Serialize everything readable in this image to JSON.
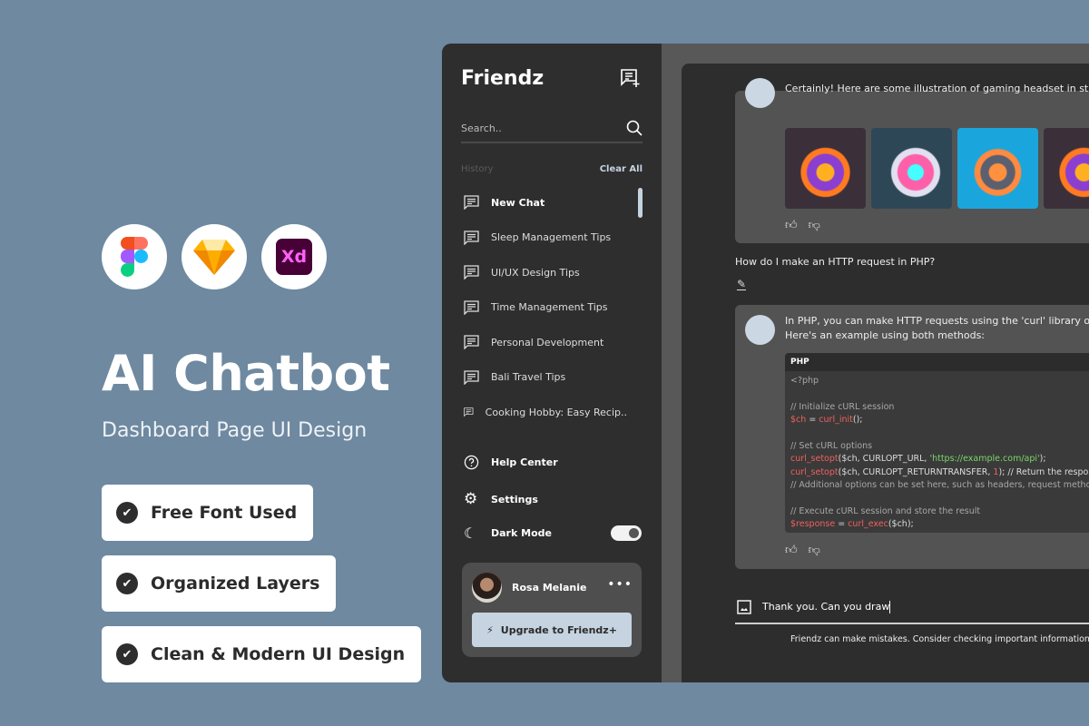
{
  "promo": {
    "title": "AI Chatbot",
    "subtitle": "Dashboard Page UI Design",
    "tools": [
      "figma-icon",
      "sketch-icon",
      "adobe-xd-icon"
    ],
    "xd_label": "Xd",
    "features": [
      "Free Font Used",
      "Organized Layers",
      "Clean & Modern UI Design"
    ]
  },
  "sidebar": {
    "logo": "Friendz",
    "search_placeholder": "Search..",
    "history_label": "History",
    "clear_all": "Clear All",
    "items": [
      "New Chat",
      "Sleep Management Tips",
      "UI/UX Design Tips",
      "Time Management Tips",
      "Personal Development",
      "Bali Travel Tips",
      "Cooking Hobby: Easy Recip.."
    ],
    "help": "Help Center",
    "settings": "Settings",
    "dark_mode": "Dark Mode",
    "dark_mode_on": true,
    "user": {
      "name": "Rosa Melanie",
      "more": "•••",
      "upgrade": "Upgrade to Friendz+"
    }
  },
  "chat": {
    "bot_msg1": "Certainly! Here are some illustration of gaming headset in st",
    "user_msg": "How do I make an HTTP request in PHP?",
    "bot_msg2": "In PHP, you can make HTTP requests using the 'curl' library or",
    "bot_msg2b": "Here's an example using both methods:",
    "code_lang": "PHP",
    "code": {
      "l1": "<?php",
      "l2": "// Initialize cURL session",
      "l3a": "$ch",
      "l3b": " = ",
      "l3c": "curl_init",
      "l3d": "();",
      "l4": "// Set cURL options",
      "l5a": "curl_setopt",
      "l5b": "($ch, CURLOPT_URL, ",
      "l5c": "'https://example.com/api'",
      "l5d": ");",
      "l6a": "curl_setopt",
      "l6b": "($ch, CURLOPT_RETURNTRANSFER, ",
      "l6c": "1",
      "l6d": "); // Return the response",
      "l7": "// Additional options can be set here, such as headers, request method",
      "l8": "// Execute cURL session and store the result",
      "l9a": "$response",
      "l9b": " = ",
      "l9c": "curl_exec",
      "l9d": "($ch);"
    },
    "input_value": "Thank you. Can you draw",
    "disclaimer": "Friendz can make mistakes. Consider checking important information."
  },
  "colors": {
    "page_bg": "#6e89a0",
    "sidebar": "#2f2e2e",
    "accent": "#c6d4e1",
    "code_red": "#f0605e",
    "code_green": "#7bd66a"
  }
}
